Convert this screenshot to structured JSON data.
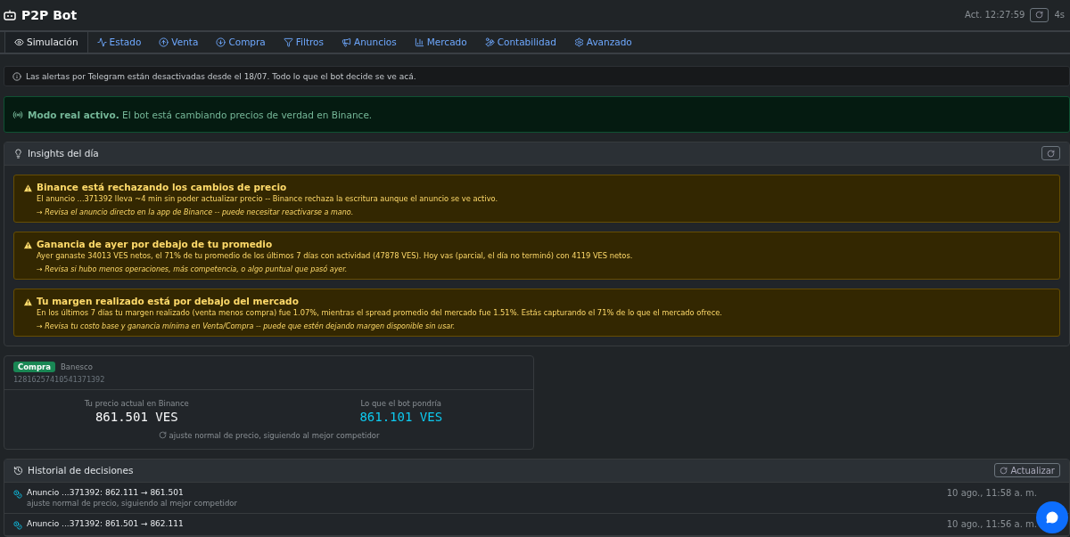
{
  "header": {
    "title": "P2P Bot",
    "updated": "Act. 12:27:59",
    "interval": "4s"
  },
  "tabs": [
    {
      "label": "Simulación",
      "selected": true
    },
    {
      "label": "Estado",
      "selected": false
    },
    {
      "label": "Venta",
      "selected": false
    },
    {
      "label": "Compra",
      "selected": false
    },
    {
      "label": "Filtros",
      "selected": false
    },
    {
      "label": "Anuncios",
      "selected": false
    },
    {
      "label": "Mercado",
      "selected": false
    },
    {
      "label": "Contabilidad",
      "selected": false
    },
    {
      "label": "Avanzado",
      "selected": false
    }
  ],
  "notice": "Las alertas por Telegram están desactivadas desde el 18/07. Todo lo que el bot decide se ve acá.",
  "mode_banner": "**Modo real activo.** El bot está cambiando precios de verdad en Binance.",
  "insights": {
    "title": "Insights del día",
    "items": [
      {
        "title": "Binance está rechazando los cambios de precio",
        "text": "El anuncio ...371392 lleva ~4 min sin poder actualizar precio -- Binance rechaza la escritura aunque el anuncio se ve activo.",
        "tip": "→ Revisa el anuncio directo en la app de Binance -- puede necesitar reactivarse a mano."
      },
      {
        "title": "Ganancia de ayer por debajo de tu promedio",
        "text": "Ayer ganaste 34013 VES netos, el 71% de tu promedio de los últimos 7 días con actividad (47878 VES). Hoy vas (parcial, el día no terminó) con 4119 VES netos.",
        "tip": "→ Revisa si hubo menos operaciones, más competencia, o algo puntual que pasó ayer."
      },
      {
        "title": "Tu margen realizado está por debajo del mercado",
        "text": "En los últimos 7 días tu margen realizado (venta menos compra) fue 1.07%, mientras el spread promedio del mercado fue 1.51%. Estás capturando el 71% de lo que el mercado ofrece.",
        "tip": "→ Revisa tu costo base y ganancia mínima en Venta/Compra -- puede que estén dejando margen disponible sin usar."
      }
    ]
  },
  "ad": {
    "side": "Compra",
    "bank": "Banesco",
    "id": "12816257410541371392",
    "current_label": "Tu precio actual en Binance",
    "current_price": "861.501 VES",
    "bot_label": "Lo que el bot pondría",
    "bot_price": "861.101 VES",
    "reason": "ajuste normal de precio, siguiendo al mejor competidor"
  },
  "history": {
    "title": "Historial de decisiones",
    "refresh": "Actualizar",
    "rows": [
      {
        "title": "Anuncio ...371392: 862.111 → 861.501",
        "detail": "ajuste normal de precio, siguiendo al mejor competidor",
        "time": "10 ago., 11:58 a. m."
      },
      {
        "title": "Anuncio ...371392: 861.501 → 862.111",
        "time": "10 ago., 11:56 a. m."
      }
    ]
  }
}
